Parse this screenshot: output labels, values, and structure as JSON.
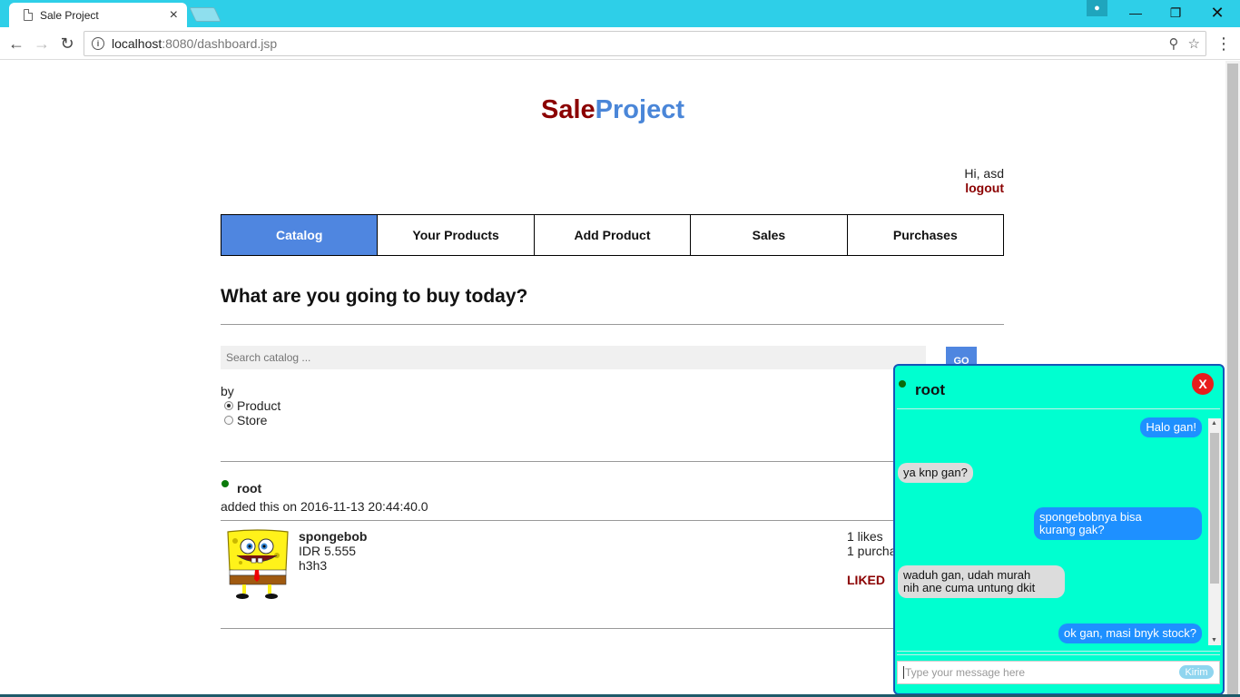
{
  "browser": {
    "tab_title": "Sale Project",
    "url_host": "localhost",
    "url_rest": ":8080/dashboard.jsp"
  },
  "header": {
    "logo_part1": "Sale",
    "logo_part2": "Project",
    "greeting": "Hi, asd",
    "logout_label": "logout"
  },
  "nav": {
    "items": [
      {
        "label": "Catalog"
      },
      {
        "label": "Your Products"
      },
      {
        "label": "Add Product"
      },
      {
        "label": "Sales"
      },
      {
        "label": "Purchases"
      }
    ]
  },
  "catalog": {
    "question": "What are you going to buy today?",
    "search_placeholder": "Search catalog ...",
    "go_label": "GO",
    "by_label": "by",
    "radio_product": "Product",
    "radio_store": "Store"
  },
  "listing": {
    "seller": "root",
    "added": "added this on 2016-11-13 20:44:40.0",
    "product_name": "spongebob",
    "price": "IDR 5.555",
    "description": "h3h3",
    "likes": "1 likes",
    "purchases": "1 purcha",
    "liked_label": "LIKED"
  },
  "chat": {
    "title": "root",
    "close_label": "X",
    "messages": [
      {
        "text": "Halo gan!"
      },
      {
        "text": "ya knp gan?"
      },
      {
        "line1": "spongebobnya bisa",
        "line2": "kurang gak?"
      },
      {
        "line1": "waduh gan, udah murah",
        "line2": "nih ane cuma untung dkit"
      },
      {
        "text": "ok gan, masi bnyk stock?"
      }
    ],
    "input_placeholder": "Type your message here",
    "send_label": "Kirim"
  }
}
